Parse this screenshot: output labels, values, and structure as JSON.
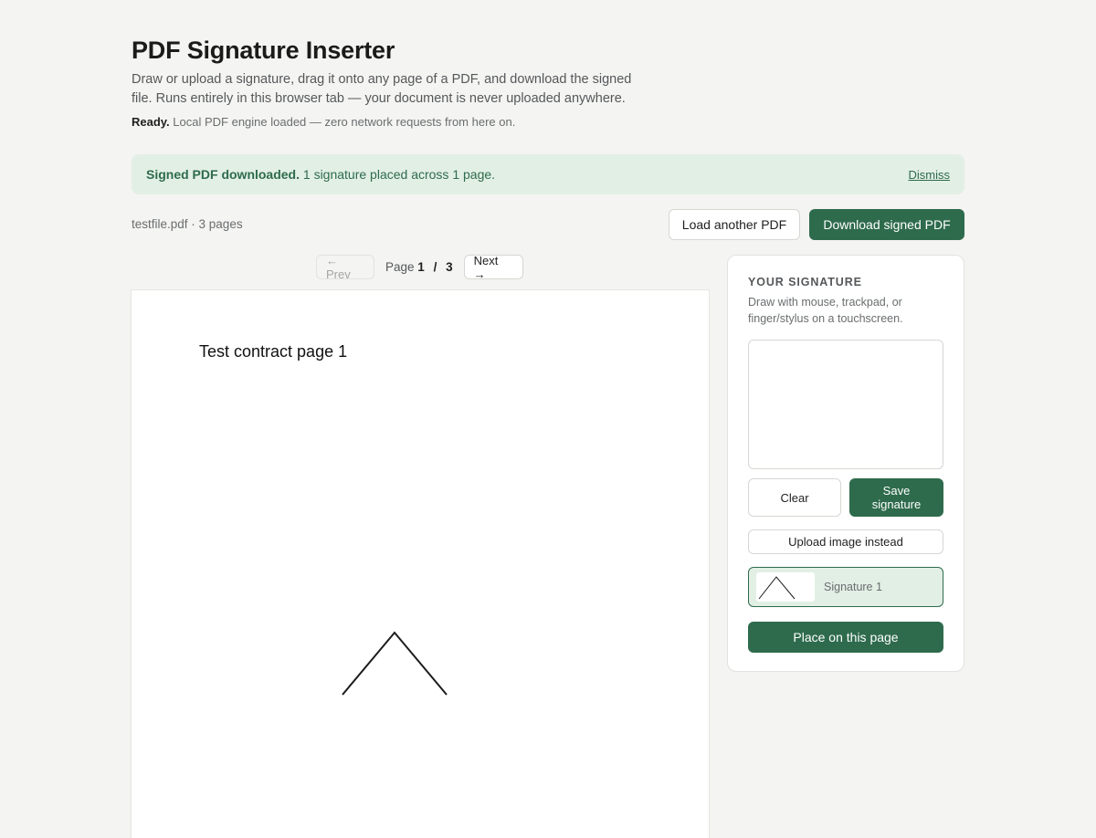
{
  "header": {
    "title": "PDF Signature Inserter",
    "intro": "Draw or upload a signature, drag it onto any page of a PDF, and download the signed file. Runs entirely in this browser tab — your document is never uploaded anywhere.",
    "status_strong": "Ready.",
    "status_text": " Local PDF engine loaded — zero network requests from here on."
  },
  "banner": {
    "strong": "Signed PDF downloaded.",
    "text": " 1 signature placed across 1 page.",
    "dismiss": "Dismiss"
  },
  "file": {
    "info": "testfile.pdf · 3 pages"
  },
  "toolbar": {
    "load_label": "Load another PDF",
    "download_label": "Download signed PDF"
  },
  "pager": {
    "prev_label": "← Prev",
    "page_word": "Page",
    "current": "1",
    "separator": "/",
    "total": "3",
    "next_label": "Next →"
  },
  "document": {
    "page_text": "Test contract page 1"
  },
  "panel": {
    "title": "YOUR SIGNATURE",
    "hint": "Draw with mouse, trackpad, or finger/stylus on a touchscreen.",
    "clear_label": "Clear",
    "save_label": "Save signature",
    "upload_label": "Upload image instead",
    "saved_signatures": [
      {
        "name": "Signature 1"
      }
    ],
    "place_label": "Place on this page"
  },
  "colors": {
    "accent": "#2e6b4c",
    "banner_bg": "#e2efe5",
    "page_bg": "#f4f4f2"
  }
}
